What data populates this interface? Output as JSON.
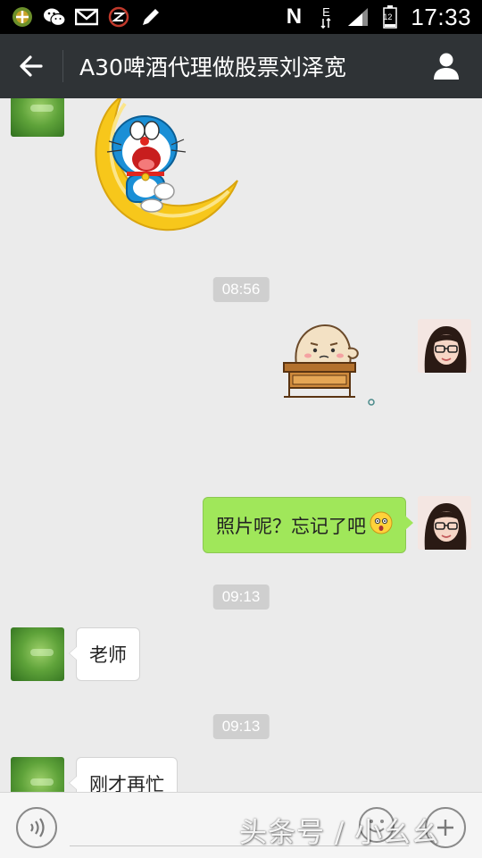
{
  "status_bar": {
    "time": "17:33",
    "battery_level": "12",
    "network_letter": "E",
    "nfc_letter": "N",
    "icons": [
      "app-icon",
      "wechat-icon",
      "mail-icon",
      "z-app-icon",
      "pen-icon"
    ]
  },
  "header": {
    "title": "A30啤酒代理做股票刘泽宽",
    "back_icon": "arrow-left-icon",
    "profile_icon": "person-icon"
  },
  "messages": [
    {
      "side": "left",
      "type": "sticker",
      "sticker": "doraemon-on-moon-sticker",
      "avatar": "green-avatar"
    },
    {
      "type": "timestamp",
      "text": "08:56"
    },
    {
      "side": "right",
      "type": "sticker",
      "sticker": "blob-at-desk-sticker",
      "avatar": "girl-avatar"
    },
    {
      "side": "right",
      "type": "text",
      "text": "照片呢？忘记了吧",
      "emoji": "surprised-emoji",
      "avatar": "girl-avatar"
    },
    {
      "type": "timestamp",
      "text": "09:13"
    },
    {
      "side": "left",
      "type": "text",
      "text": "老师",
      "avatar": "green-avatar"
    },
    {
      "type": "timestamp",
      "text": "09:13"
    },
    {
      "side": "left",
      "type": "text",
      "text": "刚才再忙",
      "avatar": "green-avatar"
    }
  ],
  "input_bar": {
    "voice_icon": "voice-icon",
    "emoji_icon": "emoji-icon",
    "plus_icon": "plus-icon"
  },
  "watermark": "头条号 / 小幺幺",
  "colors": {
    "status_bar": "#000000",
    "title_bar": "#2f3336",
    "chat_background": "#ebebeb",
    "outgoing_bubble": "#a0e75a",
    "incoming_bubble": "#ffffff",
    "timestamp_bg": "#cfcfcf"
  }
}
